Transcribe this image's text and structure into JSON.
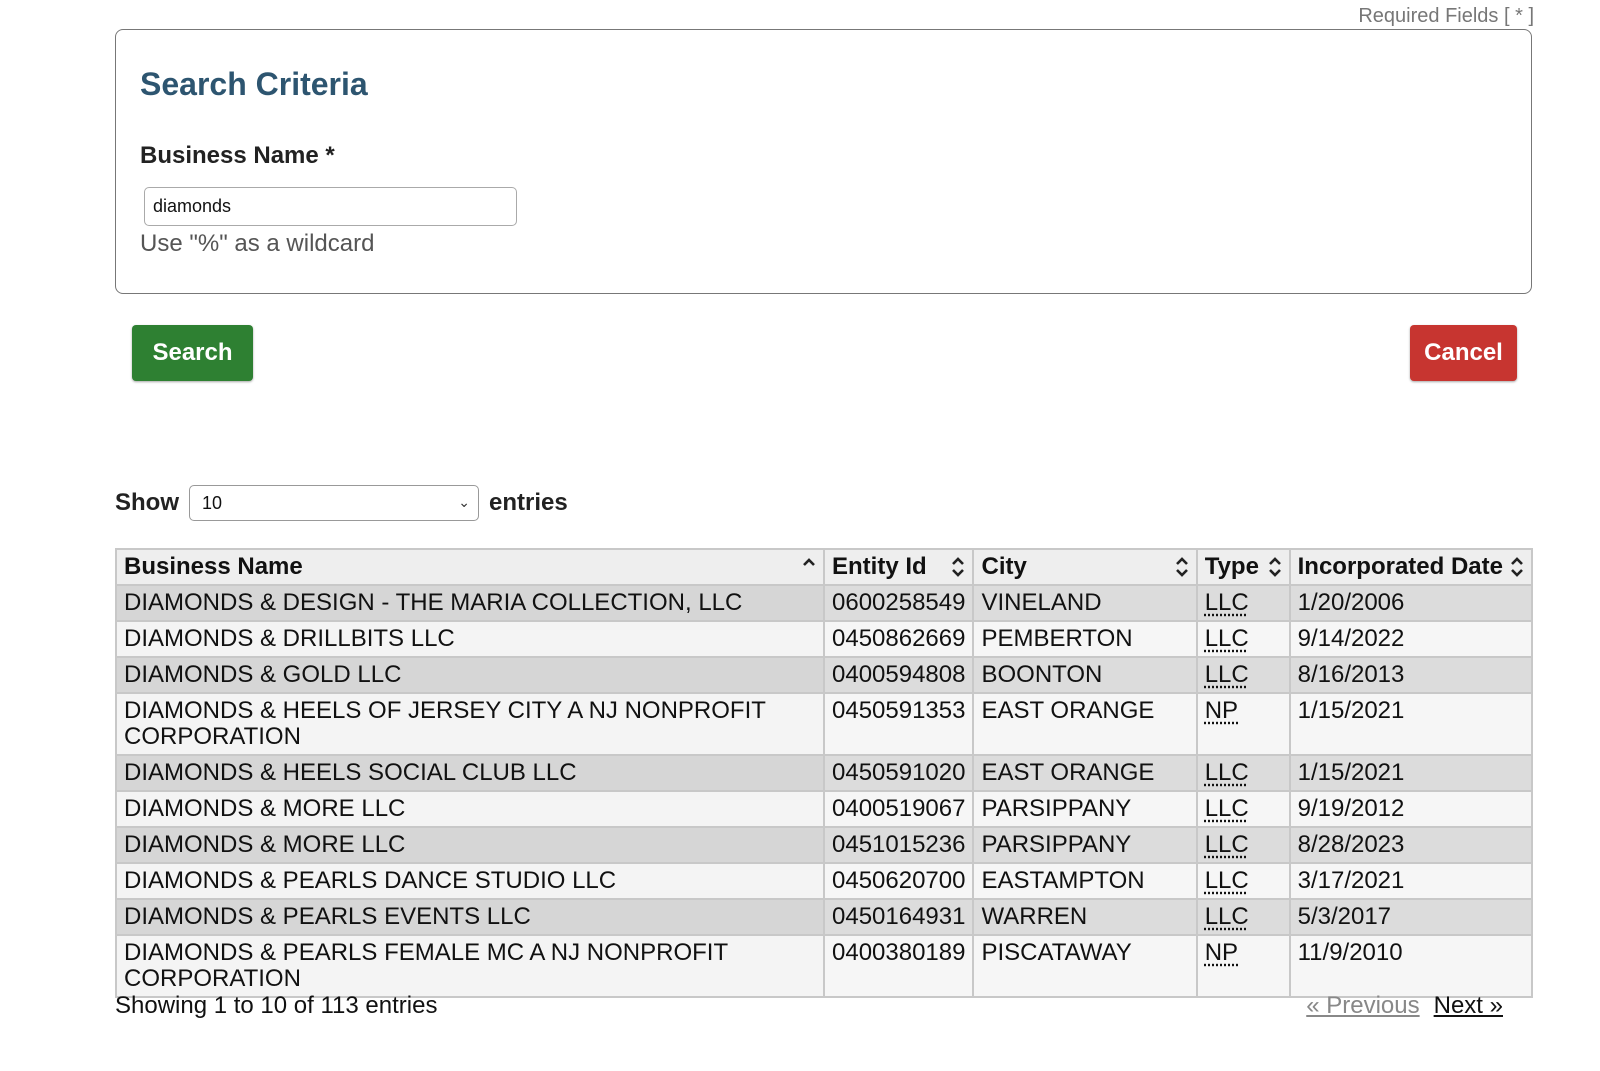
{
  "required_note": "Required Fields [ * ]",
  "criteria": {
    "title": "Search Criteria",
    "business_name_label": "Business Name *",
    "business_name_value": "diamonds",
    "hint": "Use \"%\" as a wildcard"
  },
  "buttons": {
    "search": "Search",
    "cancel": "Cancel"
  },
  "colors": {
    "search_button": "#2e8032",
    "cancel_button": "#c73530",
    "title": "#2d5570"
  },
  "length_menu": {
    "show_label": "Show",
    "selected": "10",
    "entries_label": "entries"
  },
  "table": {
    "columns": [
      {
        "label": "Business Name",
        "sort": "ascending"
      },
      {
        "label": "Entity Id",
        "sort": "both"
      },
      {
        "label": "City",
        "sort": "both"
      },
      {
        "label": "Type",
        "sort": "both"
      },
      {
        "label": "Incorporated Date",
        "sort": "both"
      }
    ],
    "rows": [
      {
        "name": "DIAMONDS & DESIGN - THE MARIA COLLECTION, LLC",
        "id": "0600258549",
        "city": "VINELAND",
        "type": "LLC",
        "date": "1/20/2006"
      },
      {
        "name": "DIAMONDS & DRILLBITS LLC",
        "id": "0450862669",
        "city": "PEMBERTON",
        "type": "LLC",
        "date": "9/14/2022"
      },
      {
        "name": "DIAMONDS & GOLD LLC",
        "id": "0400594808",
        "city": "BOONTON",
        "type": "LLC",
        "date": "8/16/2013"
      },
      {
        "name": "DIAMONDS & HEELS OF JERSEY CITY A NJ NONPROFIT CORPORATION",
        "id": "0450591353",
        "city": "EAST ORANGE",
        "type": "NP",
        "date": "1/15/2021"
      },
      {
        "name": "DIAMONDS & HEELS SOCIAL CLUB LLC",
        "id": "0450591020",
        "city": "EAST ORANGE",
        "type": "LLC",
        "date": "1/15/2021"
      },
      {
        "name": "DIAMONDS & MORE LLC",
        "id": "0400519067",
        "city": "PARSIPPANY",
        "type": "LLC",
        "date": "9/19/2012"
      },
      {
        "name": "DIAMONDS & MORE LLC",
        "id": "0451015236",
        "city": "PARSIPPANY",
        "type": "LLC",
        "date": "8/28/2023"
      },
      {
        "name": "DIAMONDS & PEARLS DANCE STUDIO LLC",
        "id": "0450620700",
        "city": "EASTAMPTON",
        "type": "LLC",
        "date": "3/17/2021"
      },
      {
        "name": "DIAMONDS & PEARLS EVENTS LLC",
        "id": "0450164931",
        "city": "WARREN",
        "type": "LLC",
        "date": "5/3/2017"
      },
      {
        "name": "DIAMONDS & PEARLS FEMALE MC A NJ NONPROFIT CORPORATION",
        "id": "0400380189",
        "city": "PISCATAWAY",
        "type": "NP",
        "date": "11/9/2010"
      }
    ]
  },
  "info": "Showing 1 to 10 of 113 entries",
  "pagination": {
    "previous": "« Previous",
    "next": "Next »"
  }
}
